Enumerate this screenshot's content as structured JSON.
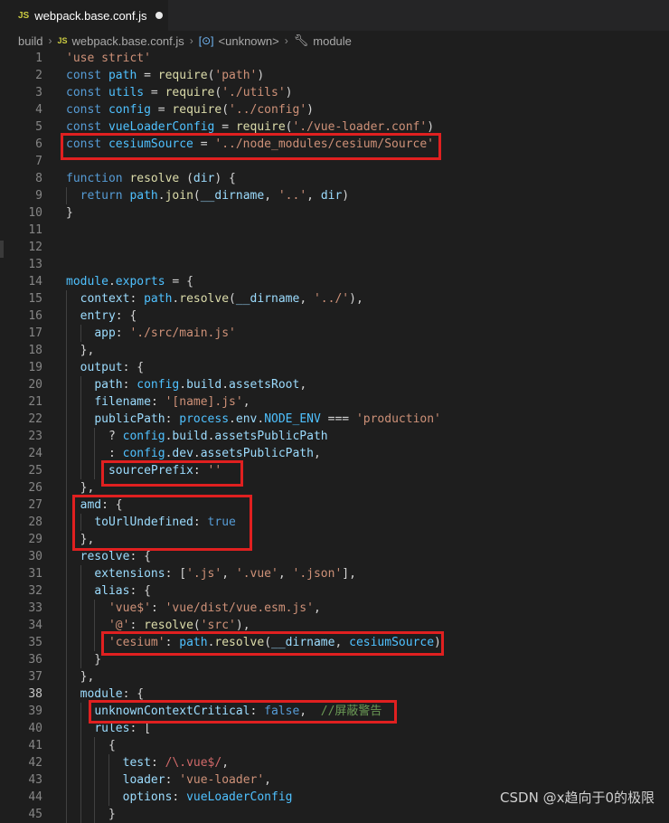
{
  "tab": {
    "badge": "JS",
    "filename": "webpack.base.conf.js"
  },
  "breadcrumb": {
    "folder": "build",
    "badge": "JS",
    "file": "webpack.base.conf.js",
    "symbol": "<unknown>",
    "module": "module"
  },
  "active_line": 38,
  "lines": [
    {
      "n": "1",
      "t": [
        [
          "str",
          "'use strict'"
        ]
      ]
    },
    {
      "n": "2",
      "t": [
        [
          "kw",
          "const "
        ],
        [
          "var",
          "path"
        ],
        [
          "plain",
          " = "
        ],
        [
          "fn",
          "require"
        ],
        [
          "plain",
          "("
        ],
        [
          "str",
          "'path'"
        ],
        [
          "plain",
          ")"
        ]
      ]
    },
    {
      "n": "3",
      "t": [
        [
          "kw",
          "const "
        ],
        [
          "var",
          "utils"
        ],
        [
          "plain",
          " = "
        ],
        [
          "fn",
          "require"
        ],
        [
          "plain",
          "("
        ],
        [
          "str",
          "'./utils'"
        ],
        [
          "plain",
          ")"
        ]
      ]
    },
    {
      "n": "4",
      "t": [
        [
          "kw",
          "const "
        ],
        [
          "var",
          "config"
        ],
        [
          "plain",
          " = "
        ],
        [
          "fn",
          "require"
        ],
        [
          "plain",
          "("
        ],
        [
          "str",
          "'../config'"
        ],
        [
          "plain",
          ")"
        ]
      ]
    },
    {
      "n": "5",
      "t": [
        [
          "kw",
          "const "
        ],
        [
          "var",
          "vueLoaderConfig"
        ],
        [
          "plain",
          " = "
        ],
        [
          "fn",
          "require"
        ],
        [
          "plain",
          "("
        ],
        [
          "str",
          "'./vue-loader.conf'"
        ],
        [
          "plain",
          ")"
        ]
      ]
    },
    {
      "n": "6",
      "t": [
        [
          "kw",
          "const "
        ],
        [
          "var",
          "cesiumSource"
        ],
        [
          "plain",
          " = "
        ],
        [
          "str",
          "'../node_modules/cesium/Source'"
        ]
      ]
    },
    {
      "n": "7",
      "t": []
    },
    {
      "n": "8",
      "t": [
        [
          "kw",
          "function "
        ],
        [
          "fn",
          "resolve"
        ],
        [
          "plain",
          " ("
        ],
        [
          "prop",
          "dir"
        ],
        [
          "plain",
          ") {"
        ]
      ]
    },
    {
      "n": "9",
      "t": [
        [
          "plain",
          "  "
        ],
        [
          "kw",
          "return "
        ],
        [
          "var",
          "path"
        ],
        [
          "plain",
          "."
        ],
        [
          "fn",
          "join"
        ],
        [
          "plain",
          "("
        ],
        [
          "prop",
          "__dirname"
        ],
        [
          "plain",
          ", "
        ],
        [
          "str",
          "'..'"
        ],
        [
          "plain",
          ", "
        ],
        [
          "prop",
          "dir"
        ],
        [
          "plain",
          ")"
        ]
      ]
    },
    {
      "n": "10",
      "t": [
        [
          "plain",
          "}"
        ]
      ]
    },
    {
      "n": "11",
      "t": []
    },
    {
      "n": "12",
      "t": []
    },
    {
      "n": "13",
      "t": []
    },
    {
      "n": "14",
      "t": [
        [
          "var",
          "module"
        ],
        [
          "plain",
          "."
        ],
        [
          "var",
          "exports"
        ],
        [
          "plain",
          " = {"
        ]
      ]
    },
    {
      "n": "15",
      "t": [
        [
          "plain",
          "  "
        ],
        [
          "prop",
          "context"
        ],
        [
          "plain",
          ": "
        ],
        [
          "var",
          "path"
        ],
        [
          "plain",
          "."
        ],
        [
          "fn",
          "resolve"
        ],
        [
          "plain",
          "("
        ],
        [
          "prop",
          "__dirname"
        ],
        [
          "plain",
          ", "
        ],
        [
          "str",
          "'../'"
        ],
        [
          "plain",
          "),"
        ]
      ]
    },
    {
      "n": "16",
      "t": [
        [
          "plain",
          "  "
        ],
        [
          "prop",
          "entry"
        ],
        [
          "plain",
          ": {"
        ]
      ]
    },
    {
      "n": "17",
      "t": [
        [
          "plain",
          "    "
        ],
        [
          "prop",
          "app"
        ],
        [
          "plain",
          ": "
        ],
        [
          "str",
          "'./src/main.js'"
        ]
      ]
    },
    {
      "n": "18",
      "t": [
        [
          "plain",
          "  },"
        ]
      ]
    },
    {
      "n": "19",
      "t": [
        [
          "plain",
          "  "
        ],
        [
          "prop",
          "output"
        ],
        [
          "plain",
          ": {"
        ]
      ]
    },
    {
      "n": "20",
      "t": [
        [
          "plain",
          "    "
        ],
        [
          "prop",
          "path"
        ],
        [
          "plain",
          ": "
        ],
        [
          "var",
          "config"
        ],
        [
          "plain",
          "."
        ],
        [
          "prop",
          "build"
        ],
        [
          "plain",
          "."
        ],
        [
          "prop",
          "assetsRoot"
        ],
        [
          "plain",
          ","
        ]
      ]
    },
    {
      "n": "21",
      "t": [
        [
          "plain",
          "    "
        ],
        [
          "prop",
          "filename"
        ],
        [
          "plain",
          ": "
        ],
        [
          "str",
          "'[name].js'"
        ],
        [
          "plain",
          ","
        ]
      ]
    },
    {
      "n": "22",
      "t": [
        [
          "plain",
          "    "
        ],
        [
          "prop",
          "publicPath"
        ],
        [
          "plain",
          ": "
        ],
        [
          "var",
          "process"
        ],
        [
          "plain",
          "."
        ],
        [
          "prop",
          "env"
        ],
        [
          "plain",
          "."
        ],
        [
          "cons",
          "NODE_ENV"
        ],
        [
          "plain",
          " === "
        ],
        [
          "str",
          "'production'"
        ]
      ]
    },
    {
      "n": "23",
      "t": [
        [
          "plain",
          "      ? "
        ],
        [
          "var",
          "config"
        ],
        [
          "plain",
          "."
        ],
        [
          "prop",
          "build"
        ],
        [
          "plain",
          "."
        ],
        [
          "prop",
          "assetsPublicPath"
        ]
      ]
    },
    {
      "n": "24",
      "t": [
        [
          "plain",
          "      : "
        ],
        [
          "var",
          "config"
        ],
        [
          "plain",
          "."
        ],
        [
          "prop",
          "dev"
        ],
        [
          "plain",
          "."
        ],
        [
          "prop",
          "assetsPublicPath"
        ],
        [
          "plain",
          ","
        ]
      ]
    },
    {
      "n": "25",
      "t": [
        [
          "plain",
          "      "
        ],
        [
          "prop",
          "sourcePrefix"
        ],
        [
          "plain",
          ": "
        ],
        [
          "str",
          "''"
        ]
      ]
    },
    {
      "n": "26",
      "t": [
        [
          "plain",
          "  },"
        ]
      ]
    },
    {
      "n": "27",
      "t": [
        [
          "plain",
          "  "
        ],
        [
          "prop",
          "amd"
        ],
        [
          "plain",
          ": {"
        ]
      ]
    },
    {
      "n": "28",
      "t": [
        [
          "plain",
          "    "
        ],
        [
          "prop",
          "toUrlUndefined"
        ],
        [
          "plain",
          ": "
        ],
        [
          "bool",
          "true"
        ]
      ]
    },
    {
      "n": "29",
      "t": [
        [
          "plain",
          "  },"
        ]
      ]
    },
    {
      "n": "30",
      "t": [
        [
          "plain",
          "  "
        ],
        [
          "prop",
          "resolve"
        ],
        [
          "plain",
          ": {"
        ]
      ]
    },
    {
      "n": "31",
      "t": [
        [
          "plain",
          "    "
        ],
        [
          "prop",
          "extensions"
        ],
        [
          "plain",
          ": ["
        ],
        [
          "str",
          "'.js'"
        ],
        [
          "plain",
          ", "
        ],
        [
          "str",
          "'.vue'"
        ],
        [
          "plain",
          ", "
        ],
        [
          "str",
          "'.json'"
        ],
        [
          "plain",
          "],"
        ]
      ]
    },
    {
      "n": "32",
      "t": [
        [
          "plain",
          "    "
        ],
        [
          "prop",
          "alias"
        ],
        [
          "plain",
          ": {"
        ]
      ]
    },
    {
      "n": "33",
      "t": [
        [
          "plain",
          "      "
        ],
        [
          "str",
          "'vue$'"
        ],
        [
          "plain",
          ": "
        ],
        [
          "str",
          "'vue/dist/vue.esm.js'"
        ],
        [
          "plain",
          ","
        ]
      ]
    },
    {
      "n": "34",
      "t": [
        [
          "plain",
          "      "
        ],
        [
          "str",
          "'@'"
        ],
        [
          "plain",
          ": "
        ],
        [
          "fn",
          "resolve"
        ],
        [
          "plain",
          "("
        ],
        [
          "str",
          "'src'"
        ],
        [
          "plain",
          "),"
        ]
      ]
    },
    {
      "n": "35",
      "t": [
        [
          "plain",
          "      "
        ],
        [
          "str",
          "'cesium'"
        ],
        [
          "plain",
          ": "
        ],
        [
          "var",
          "path"
        ],
        [
          "plain",
          "."
        ],
        [
          "fn",
          "resolve"
        ],
        [
          "plain",
          "("
        ],
        [
          "prop",
          "__dirname"
        ],
        [
          "plain",
          ", "
        ],
        [
          "var",
          "cesiumSource"
        ],
        [
          "plain",
          ")"
        ]
      ]
    },
    {
      "n": "36",
      "t": [
        [
          "plain",
          "    }"
        ]
      ]
    },
    {
      "n": "37",
      "t": [
        [
          "plain",
          "  },"
        ]
      ]
    },
    {
      "n": "38",
      "t": [
        [
          "plain",
          "  "
        ],
        [
          "prop",
          "module"
        ],
        [
          "plain",
          ": {"
        ]
      ]
    },
    {
      "n": "39",
      "t": [
        [
          "plain",
          "    "
        ],
        [
          "prop",
          "unknownContextCritical"
        ],
        [
          "plain",
          ": "
        ],
        [
          "bool",
          "false"
        ],
        [
          "plain",
          ",  "
        ],
        [
          "cmt",
          "//屏蔽警告"
        ]
      ]
    },
    {
      "n": "40",
      "t": [
        [
          "plain",
          "    "
        ],
        [
          "prop",
          "rules"
        ],
        [
          "plain",
          ": ["
        ]
      ]
    },
    {
      "n": "41",
      "t": [
        [
          "plain",
          "      {"
        ]
      ]
    },
    {
      "n": "42",
      "t": [
        [
          "plain",
          "        "
        ],
        [
          "prop",
          "test"
        ],
        [
          "plain",
          ": "
        ],
        [
          "rx",
          "/\\.vue$/"
        ],
        [
          "plain",
          ","
        ]
      ]
    },
    {
      "n": "43",
      "t": [
        [
          "plain",
          "        "
        ],
        [
          "prop",
          "loader"
        ],
        [
          "plain",
          ": "
        ],
        [
          "str",
          "'vue-loader'"
        ],
        [
          "plain",
          ","
        ]
      ]
    },
    {
      "n": "44",
      "t": [
        [
          "plain",
          "        "
        ],
        [
          "prop",
          "options"
        ],
        [
          "plain",
          ": "
        ],
        [
          "var",
          "vueLoaderConfig"
        ]
      ]
    },
    {
      "n": "45",
      "t": [
        [
          "plain",
          "      }"
        ]
      ]
    }
  ],
  "watermark": "CSDN @x趋向于0的极限"
}
